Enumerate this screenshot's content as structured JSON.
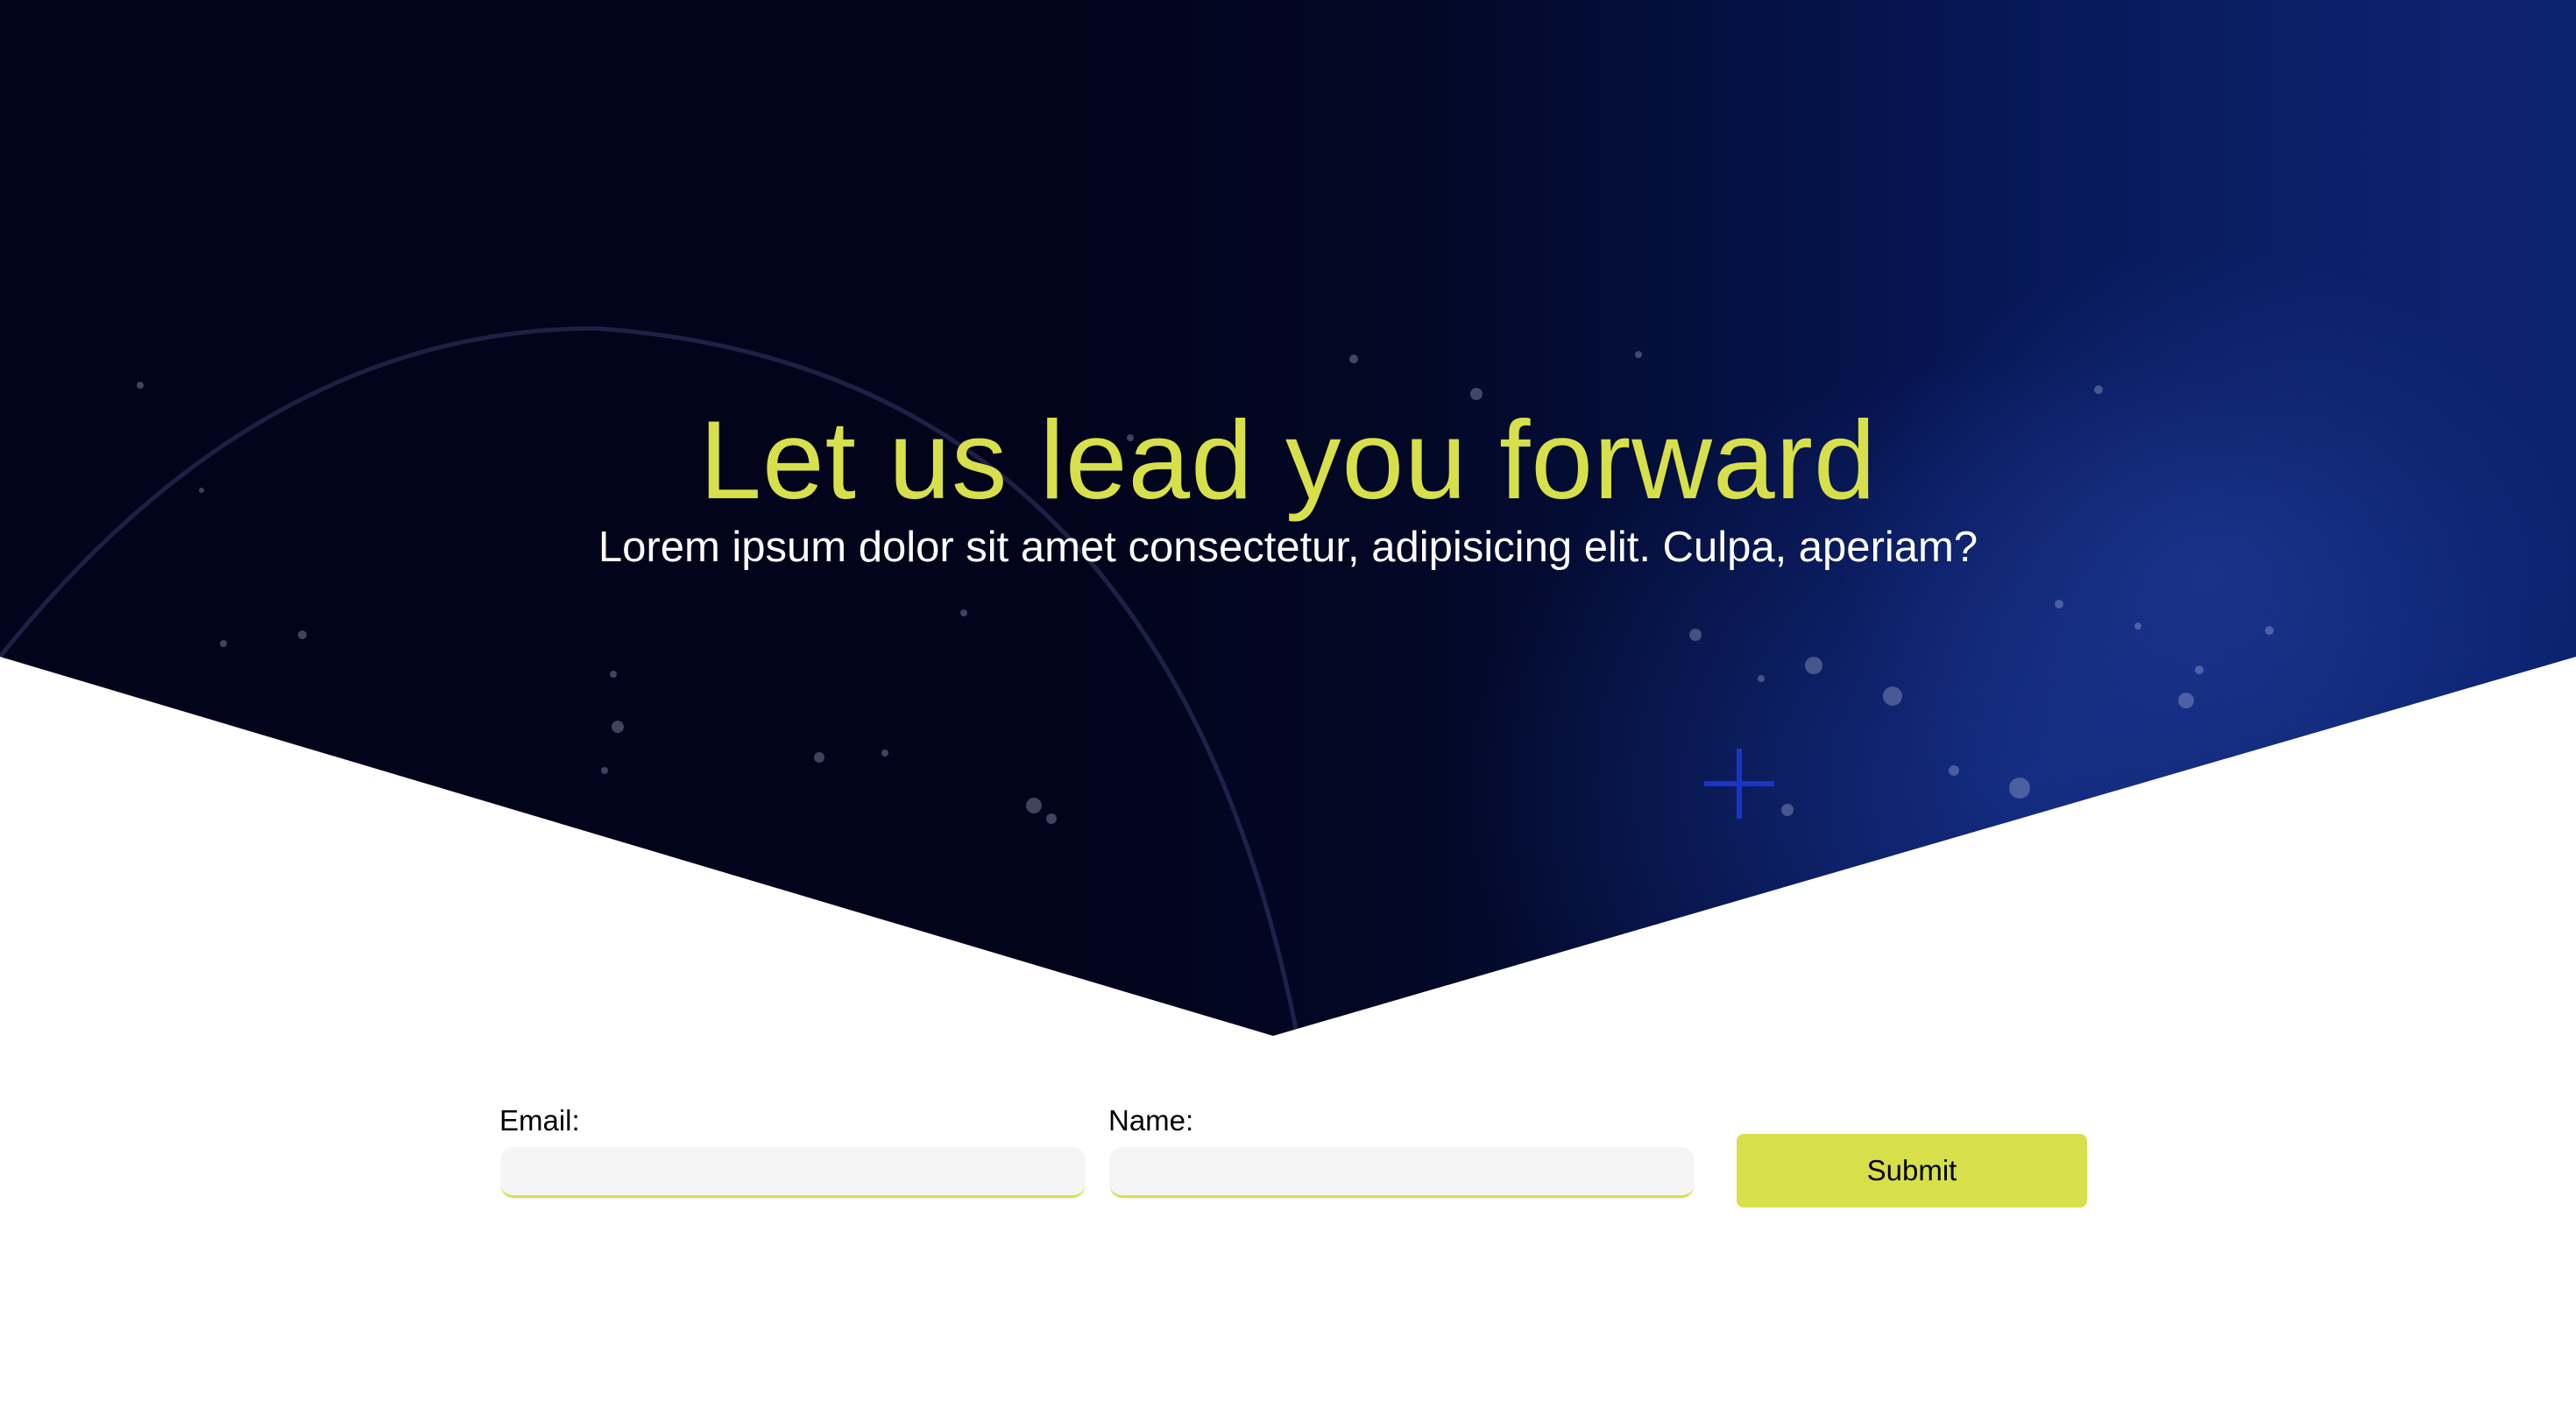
{
  "hero": {
    "title": "Let us lead you forward",
    "subtitle": "Lorem ipsum dolor sit amet consectetur, adipisicing elit. Culpa, aperiam?"
  },
  "form": {
    "email_label": "Email:",
    "email_value": "",
    "name_label": "Name:",
    "name_value": "",
    "submit_label": "Submit"
  },
  "colors": {
    "accent": "#d7e04b",
    "hero_dark": "#01041a",
    "hero_blue": "#0c2372",
    "input_bg": "#f5f5f5"
  },
  "icons": [
    "plus-icon"
  ]
}
